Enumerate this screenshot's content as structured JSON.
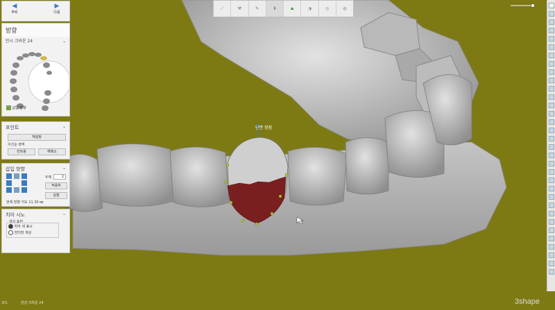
{
  "nav": {
    "prev_label": "후퇴",
    "next_label": "다음"
  },
  "direction_panel": {
    "title": "방향",
    "subtitle": "인시 크라운 24",
    "option_label": "삽입 방향"
  },
  "points_panel": {
    "title": "포인트",
    "reset_button": "재설정",
    "section_label": "우선순 영역",
    "left_button": "컨트롤",
    "right_button": "해제소"
  },
  "insertion_panel": {
    "title": "삽입 방향",
    "thickness_label": "두께",
    "thickness_value": "2",
    "unit": "",
    "apply_button": "적용하",
    "execute_button": "실행",
    "info_text": "현재 방향 각도 11.30 ㎜"
  },
  "adjust_panel": {
    "title": "치아 시노",
    "group_label": "색상 표현",
    "radio_1": "치아 색 표시",
    "radio_2": "언더컷 색상"
  },
  "model_label": "단면 정점",
  "status": {
    "line1": "모드",
    "line2": "완성 크라운 24",
    "line3": ""
  },
  "brand": "3shape",
  "icons": [
    "arrow-left-icon",
    "arrow-right-icon",
    "tooth-icon",
    "cursor-icon"
  ],
  "colors": {
    "background": "#7d7a14",
    "undercut": "#7a1f1f",
    "tooth": "#c8c8c8",
    "accent": "#3a7cc2"
  }
}
